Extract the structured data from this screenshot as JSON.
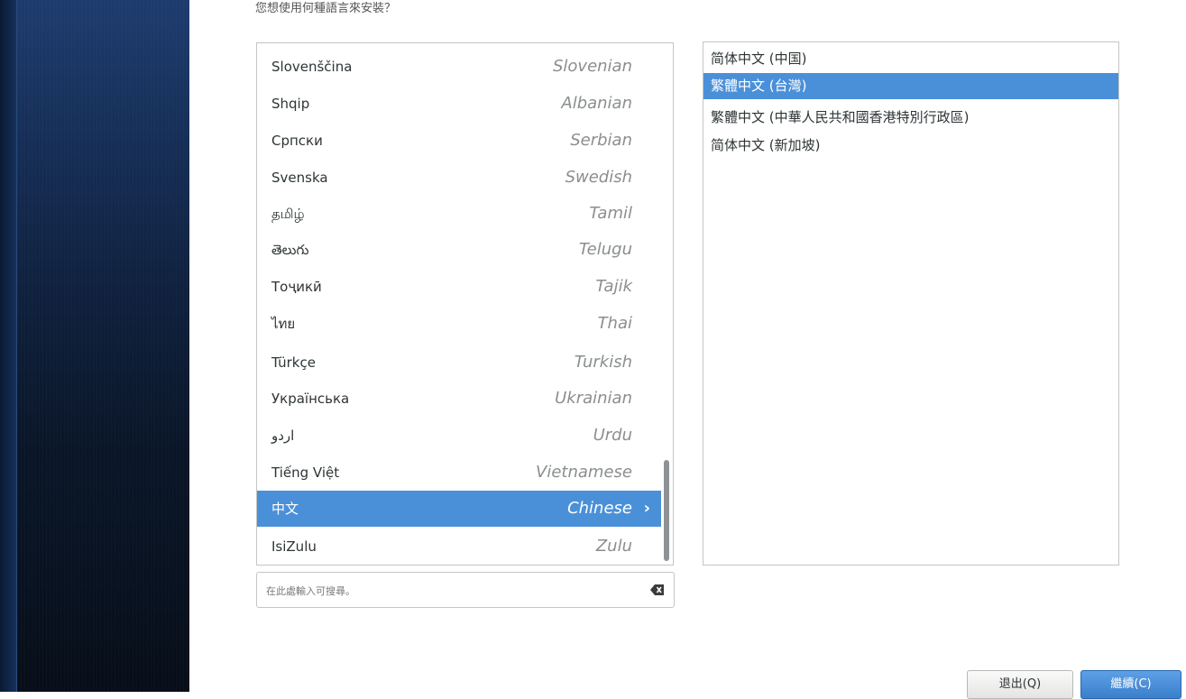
{
  "prompt": "您想使用何種語言來安裝？",
  "languages": [
    {
      "native": "Slovenščina",
      "english": "Slovenian"
    },
    {
      "native": "Shqip",
      "english": "Albanian"
    },
    {
      "native": "Српски",
      "english": "Serbian"
    },
    {
      "native": "Svenska",
      "english": "Swedish"
    },
    {
      "native": "தமிழ்",
      "english": "Tamil"
    },
    {
      "native": "తెలుగు",
      "english": "Telugu"
    },
    {
      "native": "Тоҷикӣ",
      "english": "Tajik"
    },
    {
      "native": "ไทย",
      "english": "Thai"
    },
    {
      "native": "Türkçe",
      "english": "Turkish"
    },
    {
      "native": "Українська",
      "english": "Ukrainian"
    },
    {
      "native": "اردو",
      "english": "Urdu"
    },
    {
      "native": "Tiếng Việt",
      "english": "Vietnamese"
    },
    {
      "native": "中文",
      "english": "Chinese",
      "selected": true
    },
    {
      "native": "IsiZulu",
      "english": "Zulu"
    }
  ],
  "locales": [
    {
      "label": "简体中文 (中国)"
    },
    {
      "label": "繁體中文 (台灣)",
      "selected": true
    },
    {
      "label": "繁體中文 (中華人民共和國香港特別行政區)"
    },
    {
      "label": "简体中文 (新加坡)"
    }
  ],
  "search": {
    "placeholder": "在此處輸入可搜尋。"
  },
  "buttons": {
    "quit": "退出(Q)",
    "continue": "繼續(C)"
  },
  "colors": {
    "selection": "#4a90d9",
    "accent_button": "#3a7fcb"
  },
  "icons": {
    "selected_arrow": "chevron-right-icon",
    "clear": "clear-backspace-icon"
  }
}
